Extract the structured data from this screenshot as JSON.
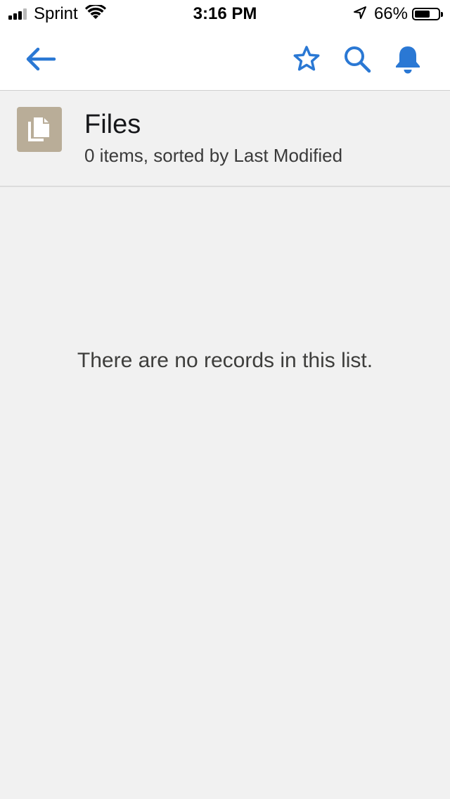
{
  "status_bar": {
    "carrier": "Sprint",
    "time": "3:16 PM",
    "battery_percent": "66%",
    "battery_level": 0.66,
    "signal_bars_active": 3,
    "signal_bars_total": 4,
    "icons": [
      "wifi-icon",
      "location-arrow-icon",
      "battery-icon"
    ]
  },
  "nav": {
    "icons": [
      "back-arrow-icon",
      "star-icon",
      "search-icon",
      "bell-icon"
    ],
    "accent_color": "#2a78d4"
  },
  "list": {
    "icon": "files-icon",
    "icon_color": "#b9ad98",
    "title": "Files",
    "subtitle": "0 items, sorted by Last Modified"
  },
  "empty_state": {
    "message": "There are no records in this list."
  }
}
